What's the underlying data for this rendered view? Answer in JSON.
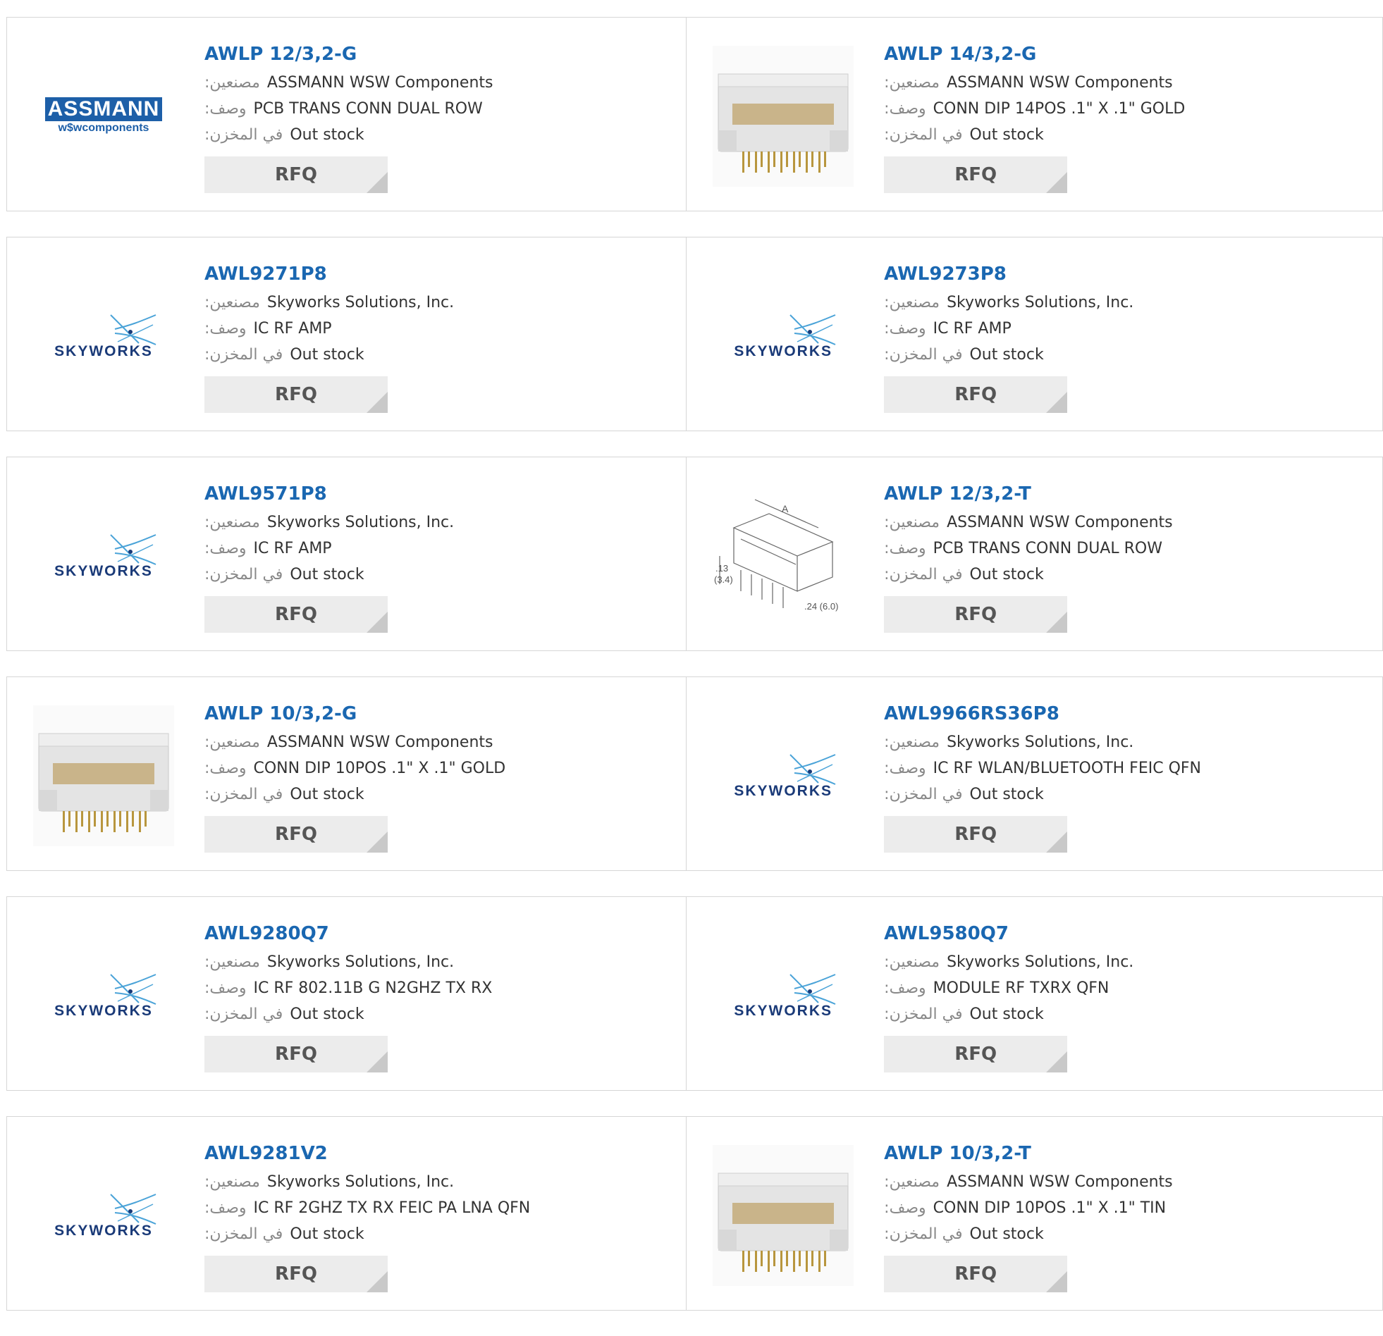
{
  "labels": {
    "manufacturer": ":مصنعين",
    "description": ":وصف",
    "stock": ":في المخزن"
  },
  "rfq_label": "RFQ",
  "logo_text": {
    "assmann_top": "ASSMANN",
    "assmann_bottom": "w$wcomponents",
    "skyworks": "SKYWORKS"
  },
  "products": [
    {
      "part": "AWLP 12/3,2-G",
      "manufacturer": "ASSMANN WSW Components",
      "description": "PCB TRANS CONN DUAL ROW",
      "stock": "Out stock",
      "image": "assmann-logo"
    },
    {
      "part": "AWLP 14/3,2-G",
      "manufacturer": "ASSMANN WSW Components",
      "description": "CONN DIP 14POS .1\" X .1\" GOLD",
      "stock": "Out stock",
      "image": "connector-photo"
    },
    {
      "part": "AWL9271P8",
      "manufacturer": "Skyworks Solutions, Inc.",
      "description": "IC RF AMP",
      "stock": "Out stock",
      "image": "skyworks-logo"
    },
    {
      "part": "AWL9273P8",
      "manufacturer": "Skyworks Solutions, Inc.",
      "description": "IC RF AMP",
      "stock": "Out stock",
      "image": "skyworks-logo"
    },
    {
      "part": "AWL9571P8",
      "manufacturer": "Skyworks Solutions, Inc.",
      "description": "IC RF AMP",
      "stock": "Out stock",
      "image": "skyworks-logo"
    },
    {
      "part": "AWLP 12/3,2-T",
      "manufacturer": "ASSMANN WSW Components",
      "description": "PCB TRANS CONN DUAL ROW",
      "stock": "Out stock",
      "image": "connector-drawing"
    },
    {
      "part": "AWLP 10/3,2-G",
      "manufacturer": "ASSMANN WSW Components",
      "description": "CONN DIP 10POS .1\" X .1\" GOLD",
      "stock": "Out stock",
      "image": "connector-photo"
    },
    {
      "part": "AWL9966RS36P8",
      "manufacturer": "Skyworks Solutions, Inc.",
      "description": "IC RF WLAN/BLUETOOTH FEIC QFN",
      "stock": "Out stock",
      "image": "skyworks-logo"
    },
    {
      "part": "AWL9280Q7",
      "manufacturer": "Skyworks Solutions, Inc.",
      "description": "IC RF 802.11B G N2GHZ TX RX",
      "stock": "Out stock",
      "image": "skyworks-logo"
    },
    {
      "part": "AWL9580Q7",
      "manufacturer": "Skyworks Solutions, Inc.",
      "description": "MODULE RF TXRX QFN",
      "stock": "Out stock",
      "image": "skyworks-logo"
    },
    {
      "part": "AWL9281V2",
      "manufacturer": "Skyworks Solutions, Inc.",
      "description": "IC RF 2GHZ TX RX FEIC PA LNA QFN",
      "stock": "Out stock",
      "image": "skyworks-logo"
    },
    {
      "part": "AWLP 10/3,2-T",
      "manufacturer": "ASSMANN WSW Components",
      "description": "CONN DIP 10POS .1\" X .1\" TIN",
      "stock": "Out stock",
      "image": "connector-photo"
    }
  ],
  "drawing_labels": {
    "dim_a": "A",
    "dim_h": ".13",
    "dim_h_mm": "(3.4)",
    "dim_w": ".24 (6.0)"
  },
  "colors": {
    "part_link": "#1a67b1",
    "assmann_brand": "#1d5fa8",
    "skyworks_brand": "#1a3a78",
    "button_bg": "#ececec"
  }
}
